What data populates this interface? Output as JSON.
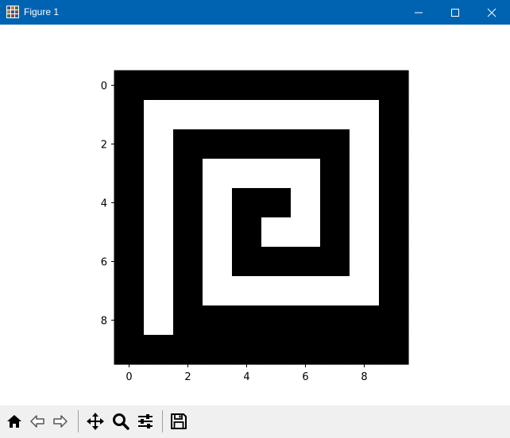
{
  "window": {
    "title": "Figure 1",
    "controls": [
      "minimize",
      "maximize",
      "close"
    ],
    "titlebar_color": "#0063b1"
  },
  "toolbar": {
    "buttons": [
      {
        "name": "home",
        "icon": "home-icon"
      },
      {
        "name": "back",
        "icon": "back-arrow-icon"
      },
      {
        "name": "forward",
        "icon": "forward-arrow-icon"
      },
      {
        "name": "pan",
        "icon": "move-icon"
      },
      {
        "name": "zoom",
        "icon": "magnifier-icon"
      },
      {
        "name": "configure-subplots",
        "icon": "sliders-icon"
      },
      {
        "name": "save",
        "icon": "floppy-disk-icon"
      }
    ]
  },
  "chart_data": {
    "type": "heatmap",
    "title": "",
    "xlabel": "",
    "ylabel": "",
    "colormap": "gray (0 = black, 1 = white)",
    "rows": 10,
    "cols": 10,
    "x_ticks": [
      0,
      2,
      4,
      6,
      8
    ],
    "y_ticks": [
      0,
      2,
      4,
      6,
      8
    ],
    "y_axis_inverted": true,
    "values": [
      [
        0,
        0,
        0,
        0,
        0,
        0,
        0,
        0,
        0,
        0
      ],
      [
        0,
        1,
        1,
        1,
        1,
        1,
        1,
        1,
        1,
        0
      ],
      [
        0,
        1,
        0,
        0,
        0,
        0,
        0,
        0,
        1,
        0
      ],
      [
        0,
        1,
        0,
        1,
        1,
        1,
        1,
        0,
        1,
        0
      ],
      [
        0,
        1,
        0,
        1,
        0,
        0,
        1,
        0,
        1,
        0
      ],
      [
        0,
        1,
        0,
        1,
        0,
        1,
        1,
        0,
        1,
        0
      ],
      [
        0,
        1,
        0,
        1,
        0,
        0,
        0,
        0,
        1,
        0
      ],
      [
        0,
        1,
        0,
        1,
        1,
        1,
        1,
        1,
        1,
        0
      ],
      [
        0,
        1,
        0,
        0,
        0,
        0,
        0,
        0,
        0,
        0
      ],
      [
        0,
        0,
        0,
        0,
        0,
        0,
        0,
        0,
        0,
        0
      ]
    ]
  }
}
